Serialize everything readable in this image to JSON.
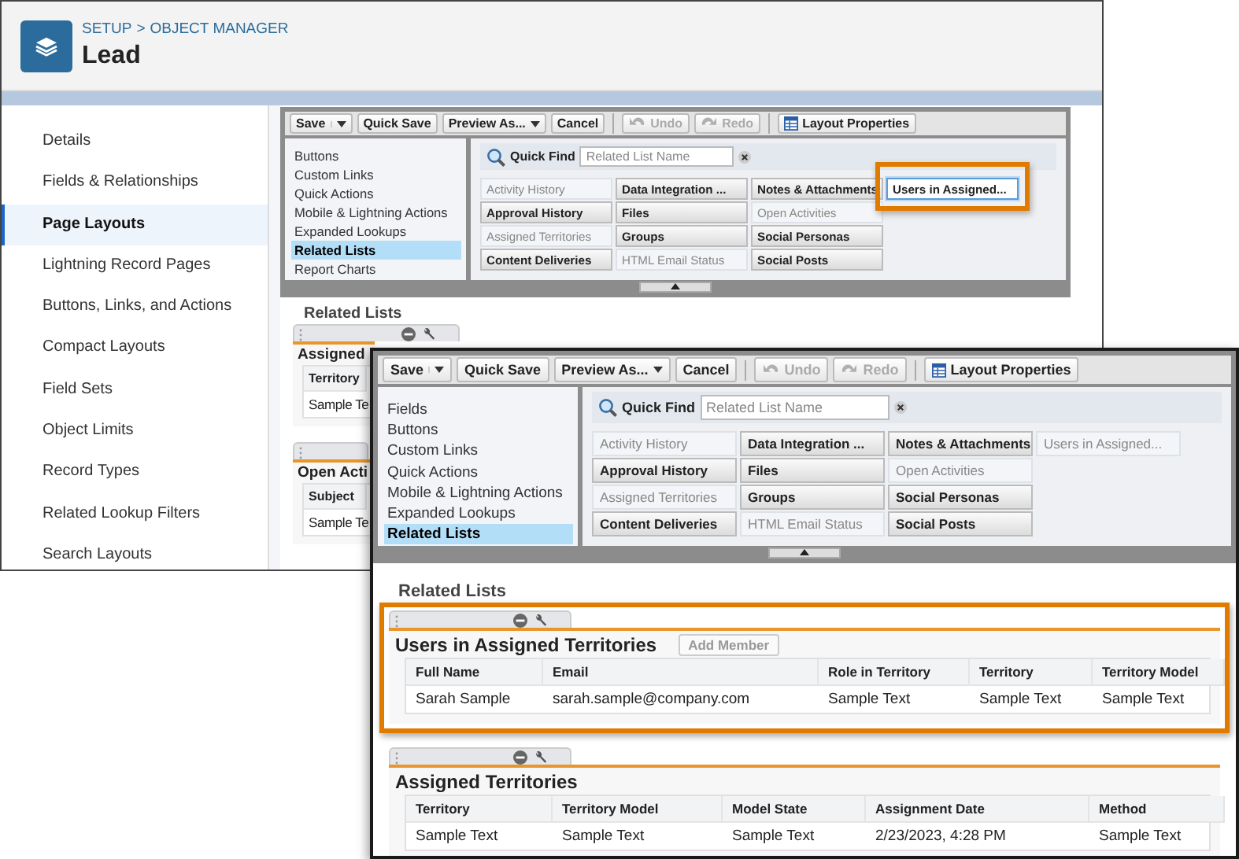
{
  "back_window": {
    "breadcrumb": {
      "items": [
        "SETUP",
        "OBJECT MANAGER"
      ],
      "separator": ">"
    },
    "title": "Lead",
    "sidebar": [
      {
        "label": "Details",
        "selected": false
      },
      {
        "label": "Fields & Relationships",
        "selected": false
      },
      {
        "label": "Page Layouts",
        "selected": true
      },
      {
        "label": "Lightning Record Pages",
        "selected": false
      },
      {
        "label": "Buttons, Links, and Actions",
        "selected": false
      },
      {
        "label": "Compact Layouts",
        "selected": false
      },
      {
        "label": "Field Sets",
        "selected": false
      },
      {
        "label": "Object Limits",
        "selected": false
      },
      {
        "label": "Record Types",
        "selected": false
      },
      {
        "label": "Related Lookup Filters",
        "selected": false
      },
      {
        "label": "Search Layouts",
        "selected": false
      }
    ],
    "palette": {
      "toolbar": [
        {
          "label": "Save",
          "kind": "split",
          "disabled": false,
          "separator_before": false
        },
        {
          "label": "Quick Save",
          "kind": "button",
          "disabled": false,
          "separator_before": false
        },
        {
          "label": "Preview As...",
          "kind": "menu",
          "disabled": false,
          "separator_before": false
        },
        {
          "label": "Cancel",
          "kind": "button",
          "disabled": false,
          "separator_before": false
        },
        {
          "label": "Undo",
          "kind": "undo",
          "disabled": true,
          "separator_before": true
        },
        {
          "label": "Redo",
          "kind": "redo",
          "disabled": true,
          "separator_before": false
        },
        {
          "label": "Layout Properties",
          "kind": "properties",
          "disabled": false,
          "separator_before": true
        }
      ],
      "categories": [
        {
          "label": "Buttons",
          "selected": false
        },
        {
          "label": "Custom Links",
          "selected": false
        },
        {
          "label": "Quick Actions",
          "selected": false
        },
        {
          "label": "Mobile & Lightning Actions",
          "selected": false
        },
        {
          "label": "Expanded Lookups",
          "selected": false
        },
        {
          "label": "Related Lists",
          "selected": true
        },
        {
          "label": "Report Charts",
          "selected": false
        }
      ],
      "quick_find": {
        "label": "Quick Find",
        "placeholder": "Related List Name"
      },
      "items": [
        {
          "label": "Activity History",
          "used": true,
          "highlighted": false
        },
        {
          "label": "Approval History",
          "used": false,
          "highlighted": false
        },
        {
          "label": "Assigned Territories",
          "used": true,
          "highlighted": false
        },
        {
          "label": "Content Deliveries",
          "used": false,
          "highlighted": false
        },
        {
          "label": "Data Integration ...",
          "used": false,
          "highlighted": false
        },
        {
          "label": "Files",
          "used": false,
          "highlighted": false
        },
        {
          "label": "Groups",
          "used": false,
          "highlighted": false
        },
        {
          "label": "HTML Email Status",
          "used": true,
          "highlighted": false
        },
        {
          "label": "Notes & Attachments",
          "used": false,
          "highlighted": false
        },
        {
          "label": "Open Activities",
          "used": true,
          "highlighted": false
        },
        {
          "label": "Social Personas",
          "used": false,
          "highlighted": false
        },
        {
          "label": "Social Posts",
          "used": false,
          "highlighted": false
        },
        {
          "label": "Users in Assigned...",
          "used": false,
          "highlighted": true
        }
      ]
    },
    "related_lists": {
      "heading": "Related Lists",
      "cards": [
        {
          "title": "Assigned",
          "tab_icons": true,
          "highlighted": false,
          "columns": [
            "Territory"
          ],
          "rows": [
            [
              "Sample Te"
            ]
          ]
        },
        {
          "title": "Open Acti",
          "tab_icons": false,
          "highlighted": false,
          "columns": [
            "Subject"
          ],
          "rows": [
            [
              "Sample Te"
            ]
          ]
        }
      ]
    }
  },
  "front_window": {
    "palette": {
      "toolbar": [
        {
          "label": "Save",
          "kind": "split",
          "disabled": false,
          "separator_before": false
        },
        {
          "label": "Quick Save",
          "kind": "button",
          "disabled": false,
          "separator_before": false
        },
        {
          "label": "Preview As...",
          "kind": "menu",
          "disabled": false,
          "separator_before": false
        },
        {
          "label": "Cancel",
          "kind": "button",
          "disabled": false,
          "separator_before": false
        },
        {
          "label": "Undo",
          "kind": "undo",
          "disabled": true,
          "separator_before": true
        },
        {
          "label": "Redo",
          "kind": "redo",
          "disabled": true,
          "separator_before": false
        },
        {
          "label": "Layout Properties",
          "kind": "properties",
          "disabled": false,
          "separator_before": true
        }
      ],
      "categories": [
        {
          "label": "Fields",
          "selected": false
        },
        {
          "label": "Buttons",
          "selected": false
        },
        {
          "label": "Custom Links",
          "selected": false
        },
        {
          "label": "Quick Actions",
          "selected": false
        },
        {
          "label": "Mobile & Lightning Actions",
          "selected": false
        },
        {
          "label": "Expanded Lookups",
          "selected": false
        },
        {
          "label": "Related Lists",
          "selected": true
        }
      ],
      "quick_find": {
        "label": "Quick Find",
        "placeholder": "Related List Name"
      },
      "items": [
        {
          "label": "Activity History",
          "used": true,
          "highlighted": false
        },
        {
          "label": "Approval History",
          "used": false,
          "highlighted": false
        },
        {
          "label": "Assigned Territories",
          "used": true,
          "highlighted": false
        },
        {
          "label": "Content Deliveries",
          "used": false,
          "highlighted": false
        },
        {
          "label": "Data Integration ...",
          "used": false,
          "highlighted": false
        },
        {
          "label": "Files",
          "used": false,
          "highlighted": false
        },
        {
          "label": "Groups",
          "used": false,
          "highlighted": false
        },
        {
          "label": "HTML Email Status",
          "used": true,
          "highlighted": false
        },
        {
          "label": "Notes & Attachments",
          "used": false,
          "highlighted": false
        },
        {
          "label": "Open Activities",
          "used": true,
          "highlighted": false
        },
        {
          "label": "Social Personas",
          "used": false,
          "highlighted": false
        },
        {
          "label": "Social Posts",
          "used": false,
          "highlighted": false
        },
        {
          "label": "Users in Assigned...",
          "used": true,
          "highlighted": false
        }
      ]
    },
    "related_lists": {
      "heading": "Related Lists",
      "cards": [
        {
          "title": "Users in Assigned Territories",
          "tab_icons": true,
          "highlighted": true,
          "button": {
            "label": "Add Member",
            "disabled": true
          },
          "columns": [
            "Full Name",
            "Email",
            "Role in Territory",
            "Territory",
            "Territory Model"
          ],
          "rows": [
            [
              "Sarah Sample",
              "sarah.sample@company.com",
              "Sample Text",
              "Sample Text",
              "Sample Text"
            ]
          ]
        },
        {
          "title": "Assigned Territories",
          "tab_icons": true,
          "highlighted": false,
          "columns": [
            "Territory",
            "Territory Model",
            "Model State",
            "Assignment Date",
            "Method"
          ],
          "rows": [
            [
              "Sample Text",
              "Sample Text",
              "Sample Text",
              "2/23/2023, 4:28 PM",
              "Sample Text"
            ]
          ]
        }
      ]
    }
  }
}
